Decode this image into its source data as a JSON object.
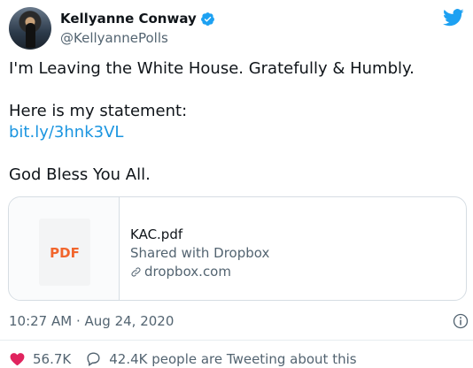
{
  "author": {
    "name": "Kellyanne Conway",
    "handle": "@KellyannePolls"
  },
  "tweet": {
    "line1": "I'm Leaving the White House. Gratefully & Humbly.",
    "line2": "Here is my statement:",
    "link": "bit.ly/3hnk3VL",
    "line3": "God Bless You All."
  },
  "card": {
    "badge": "PDF",
    "title": "KAC.pdf",
    "subtitle": "Shared with Dropbox",
    "domain": "dropbox.com"
  },
  "meta": {
    "time": "10:27 AM",
    "separator": " · ",
    "date": "Aug 24, 2020"
  },
  "actions": {
    "likes": "56.7K",
    "replies": "42.4K people are Tweeting about this"
  },
  "colors": {
    "accent": "#1da1f2",
    "link": "#1b95e0",
    "like": "#e0245e",
    "pdf": "#f1652c"
  },
  "icons": [
    "verified-badge-icon",
    "twitter-bird-icon",
    "link-icon",
    "info-icon",
    "heart-icon",
    "reply-icon"
  ]
}
